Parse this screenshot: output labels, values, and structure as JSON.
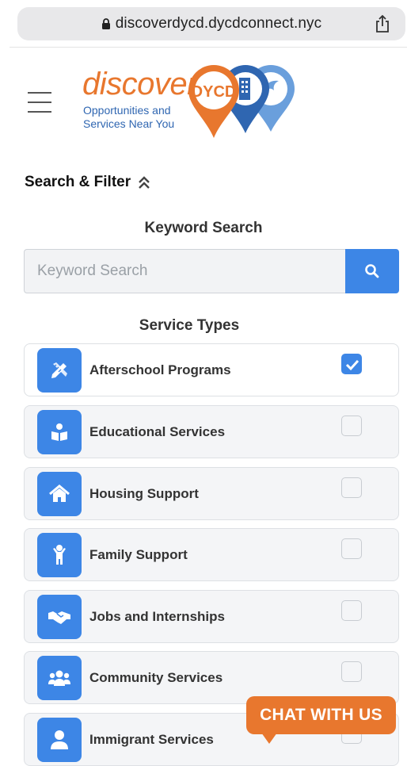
{
  "browser": {
    "url": "discoverdycd.dycdconnect.nyc"
  },
  "logo": {
    "word": "discover",
    "badge": "DYCD",
    "tagline_line1": "Opportunities and",
    "tagline_line2": "Services Near You"
  },
  "filter": {
    "title": "Search & Filter",
    "keyword_heading": "Keyword Search",
    "keyword_placeholder": "Keyword Search",
    "keyword_value": "",
    "service_types_heading": "Service Types"
  },
  "services": [
    {
      "label": "Afterschool Programs",
      "icon": "pencil-ruler-icon",
      "checked": true
    },
    {
      "label": "Educational Services",
      "icon": "reading-person-icon",
      "checked": false
    },
    {
      "label": "Housing Support",
      "icon": "home-icon",
      "checked": false
    },
    {
      "label": "Family Support",
      "icon": "child-icon",
      "checked": false
    },
    {
      "label": "Jobs and Internships",
      "icon": "handshake-icon",
      "checked": false
    },
    {
      "label": "Community Services",
      "icon": "users-icon",
      "checked": false
    },
    {
      "label": "Immigrant Services",
      "icon": "user-icon",
      "checked": false
    }
  ],
  "chat": {
    "label": "CHAT WITH US"
  },
  "colors": {
    "accent_blue": "#3d86e6",
    "brand_orange": "#e8772e",
    "brand_blue": "#2f66b1"
  }
}
